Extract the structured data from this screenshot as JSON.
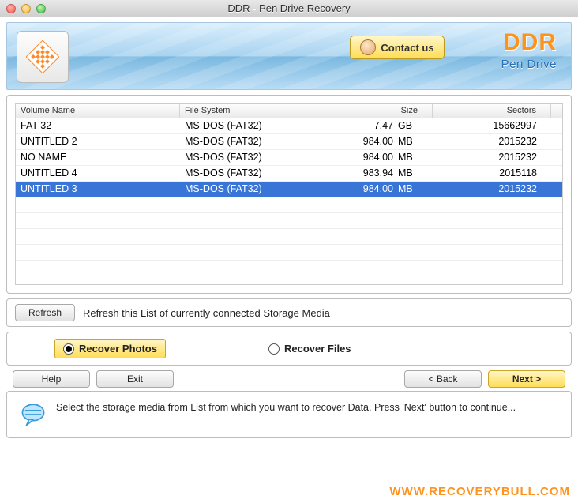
{
  "window": {
    "title": "DDR - Pen Drive Recovery"
  },
  "header": {
    "contact_label": "Contact us",
    "brand_title": "DDR",
    "brand_sub": "Pen Drive"
  },
  "table": {
    "columns": {
      "volume": "Volume Name",
      "fs": "File System",
      "size": "Size",
      "sectors": "Sectors"
    },
    "rows": [
      {
        "volume": "FAT 32",
        "fs": "MS-DOS (FAT32)",
        "size_num": "7.47",
        "size_unit": "GB",
        "sectors": "15662997",
        "selected": false
      },
      {
        "volume": "UNTITLED 2",
        "fs": "MS-DOS (FAT32)",
        "size_num": "984.00",
        "size_unit": "MB",
        "sectors": "2015232",
        "selected": false
      },
      {
        "volume": "NO NAME",
        "fs": "MS-DOS (FAT32)",
        "size_num": "984.00",
        "size_unit": "MB",
        "sectors": "2015232",
        "selected": false
      },
      {
        "volume": "UNTITLED 4",
        "fs": "MS-DOS (FAT32)",
        "size_num": "983.94",
        "size_unit": "MB",
        "sectors": "2015118",
        "selected": false
      },
      {
        "volume": "UNTITLED 3",
        "fs": "MS-DOS (FAT32)",
        "size_num": "984.00",
        "size_unit": "MB",
        "sectors": "2015232",
        "selected": true
      }
    ]
  },
  "refresh": {
    "button": "Refresh",
    "text": "Refresh this List of currently connected Storage Media"
  },
  "options": {
    "photos": "Recover Photos",
    "files": "Recover Files",
    "selected": "photos"
  },
  "nav": {
    "help": "Help",
    "exit": "Exit",
    "back": "< Back",
    "next": "Next >"
  },
  "info": {
    "text": "Select the storage media from List from which you want to recover Data. Press 'Next' button to continue..."
  },
  "watermark": "WWW.RECOVERYBULL.COM"
}
